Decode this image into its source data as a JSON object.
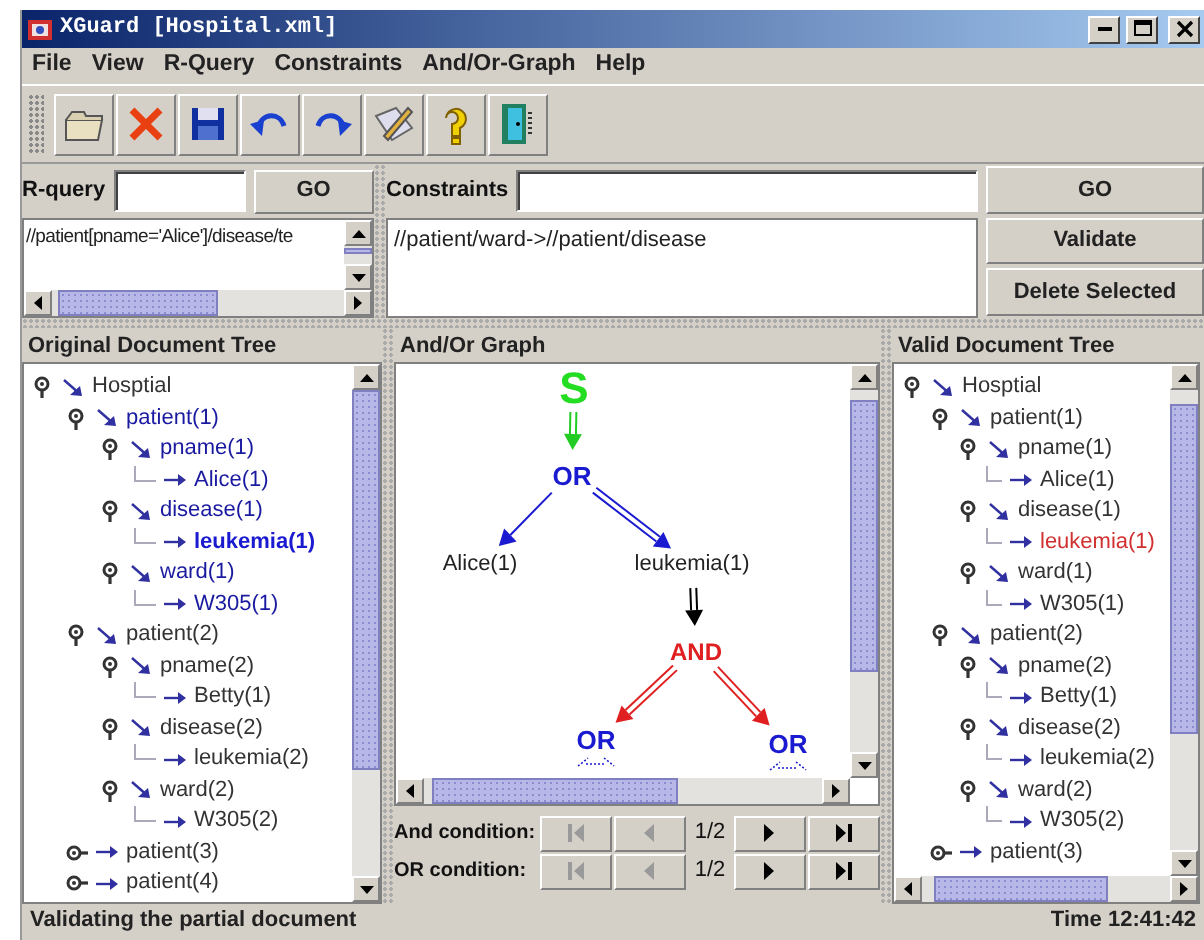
{
  "window": {
    "title": "XGuard [Hospital.xml]"
  },
  "menu": [
    "File",
    "View",
    "R-Query",
    "Constraints",
    "And/Or-Graph",
    "Help"
  ],
  "toolbar": [
    {
      "kind": "open"
    },
    {
      "kind": "delete"
    },
    {
      "kind": "save"
    },
    {
      "kind": "undo"
    },
    {
      "kind": "redo"
    },
    {
      "kind": "edit"
    },
    {
      "kind": "help"
    },
    {
      "kind": "exit"
    }
  ],
  "r_query": {
    "label": "R-query",
    "button": "GO",
    "items": [
      "//patient[pname='Alice']/disease/te"
    ]
  },
  "constraints": {
    "label": "Constraints",
    "items": [
      "//patient/ward->//patient/disease"
    ]
  },
  "actions": [
    "GO",
    "Validate",
    "Delete Selected"
  ],
  "original_tree": {
    "title": "Original Document Tree",
    "nodes": [
      {
        "kind": "element",
        "label": "Hosptial",
        "expanded": true,
        "active": false,
        "children": [
          {
            "kind": "element",
            "label": "patient(1)",
            "expanded": true,
            "active": true,
            "children": [
              {
                "kind": "element",
                "label": "pname(1)",
                "expanded": true,
                "active": true,
                "children": [
                  {
                    "kind": "value",
                    "label": "Alice(1)",
                    "active": true,
                    "marked": false
                  }
                ]
              },
              {
                "kind": "element",
                "label": "disease(1)",
                "expanded": true,
                "active": true,
                "children": [
                  {
                    "kind": "value",
                    "label": "leukemia(1)",
                    "active": true,
                    "marked": true
                  }
                ]
              },
              {
                "kind": "element",
                "label": "ward(1)",
                "expanded": true,
                "active": true,
                "children": [
                  {
                    "kind": "value",
                    "label": "W305(1)",
                    "active": true,
                    "marked": false
                  }
                ]
              }
            ]
          },
          {
            "kind": "element",
            "label": "patient(2)",
            "expanded": true,
            "active": false,
            "children": [
              {
                "kind": "element",
                "label": "pname(2)",
                "expanded": true,
                "active": false,
                "children": [
                  {
                    "kind": "value",
                    "label": "Betty(1)",
                    "active": false,
                    "marked": false
                  }
                ]
              },
              {
                "kind": "element",
                "label": "disease(2)",
                "expanded": true,
                "active": false,
                "children": [
                  {
                    "kind": "value",
                    "label": "leukemia(2)",
                    "active": false,
                    "marked": false
                  }
                ]
              },
              {
                "kind": "element",
                "label": "ward(2)",
                "expanded": true,
                "active": false,
                "children": [
                  {
                    "kind": "value",
                    "label": "W305(2)",
                    "active": false,
                    "marked": false
                  }
                ]
              }
            ]
          },
          {
            "kind": "element",
            "label": "patient(3)",
            "expanded": false,
            "active": false
          },
          {
            "kind": "element",
            "label": "patient(4)",
            "expanded": false,
            "active": false
          }
        ]
      }
    ]
  },
  "graph": {
    "title": "And/Or Graph",
    "nodes": [
      {
        "kind": "start",
        "label": "S"
      },
      {
        "kind": "or",
        "label": "OR"
      },
      {
        "kind": "value",
        "label": "Alice(1)"
      },
      {
        "kind": "value",
        "label": "leukemia(1)"
      },
      {
        "kind": "and",
        "label": "AND"
      },
      {
        "kind": "or",
        "label": "OR",
        "collapsed": true
      },
      {
        "kind": "or",
        "label": "OR",
        "collapsed": true
      }
    ],
    "conditions": [
      {
        "label": "And condition:",
        "counter": "1/2",
        "buttons": [
          {
            "kind": "first",
            "disabled": true
          },
          {
            "kind": "prev",
            "disabled": true
          },
          {
            "kind": "next",
            "disabled": false
          },
          {
            "kind": "last",
            "disabled": false
          }
        ]
      },
      {
        "label": "OR condition:",
        "counter": "1/2",
        "buttons": [
          {
            "kind": "first",
            "disabled": true
          },
          {
            "kind": "prev",
            "disabled": true
          },
          {
            "kind": "next",
            "disabled": false
          },
          {
            "kind": "last",
            "disabled": false
          }
        ]
      }
    ]
  },
  "valid_tree": {
    "title": "Valid Document Tree",
    "nodes": [
      {
        "kind": "element",
        "label": "Hosptial",
        "expanded": true,
        "active": false,
        "children": [
          {
            "kind": "element",
            "label": "patient(1)",
            "expanded": true,
            "active": false,
            "children": [
              {
                "kind": "element",
                "label": "pname(1)",
                "expanded": true,
                "active": false,
                "children": [
                  {
                    "kind": "value",
                    "label": "Alice(1)",
                    "active": false,
                    "marked": false
                  }
                ]
              },
              {
                "kind": "element",
                "label": "disease(1)",
                "expanded": true,
                "active": false,
                "children": [
                  {
                    "kind": "value",
                    "label": "leukemia(1)",
                    "active": false,
                    "marked": true
                  }
                ]
              },
              {
                "kind": "element",
                "label": "ward(1)",
                "expanded": true,
                "active": false,
                "children": [
                  {
                    "kind": "value",
                    "label": "W305(1)",
                    "active": false,
                    "marked": false
                  }
                ]
              }
            ]
          },
          {
            "kind": "element",
            "label": "patient(2)",
            "expanded": true,
            "active": false,
            "children": [
              {
                "kind": "element",
                "label": "pname(2)",
                "expanded": true,
                "active": false,
                "children": [
                  {
                    "kind": "value",
                    "label": "Betty(1)",
                    "active": false,
                    "marked": false
                  }
                ]
              },
              {
                "kind": "element",
                "label": "disease(2)",
                "expanded": true,
                "active": false,
                "children": [
                  {
                    "kind": "value",
                    "label": "leukemia(2)",
                    "active": false,
                    "marked": false
                  }
                ]
              },
              {
                "kind": "element",
                "label": "ward(2)",
                "expanded": true,
                "active": false,
                "children": [
                  {
                    "kind": "value",
                    "label": "W305(2)",
                    "active": false,
                    "marked": false
                  }
                ]
              }
            ]
          },
          {
            "kind": "element",
            "label": "patient(3)",
            "expanded": false,
            "active": false
          }
        ]
      }
    ]
  },
  "status_bar": {
    "message": "Validating the partial document",
    "time": "Time 12:41:42"
  }
}
